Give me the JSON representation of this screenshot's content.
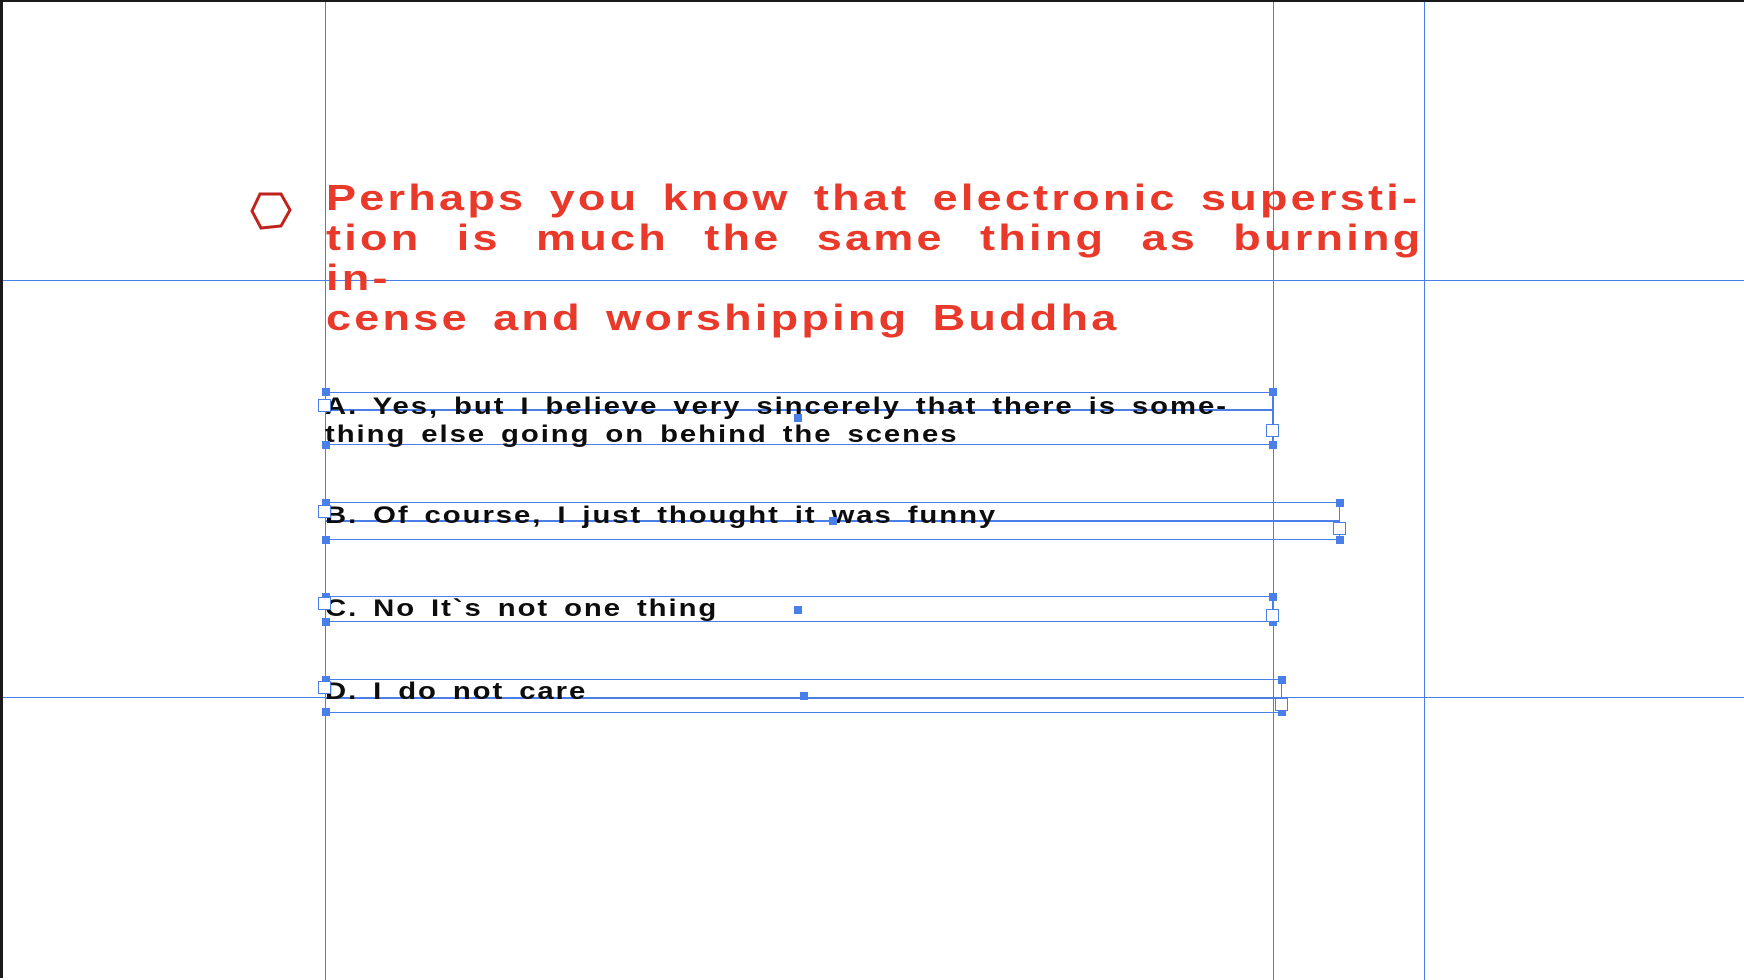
{
  "title": {
    "line1": "Perhaps you know that electronic supersti-",
    "line2": "tion is much the same thing as burning in-",
    "line3": "cense and worshipping Buddha"
  },
  "answers": [
    {
      "line1": "A. Yes, but I believe very sincerely that there is some-",
      "line2": "thing else going on behind the scenes"
    },
    {
      "line1": "B. Of course, I just thought it was funny"
    },
    {
      "line1": "C. No It`s not one thing"
    },
    {
      "line1": "D. I do not care"
    }
  ],
  "colors": {
    "title": "#e8392a",
    "answer_text": "#0d0d0d",
    "guide": "#4a7ee8",
    "hexagon": "#c0221c"
  },
  "icons": {
    "decor": "hexagon-icon"
  }
}
